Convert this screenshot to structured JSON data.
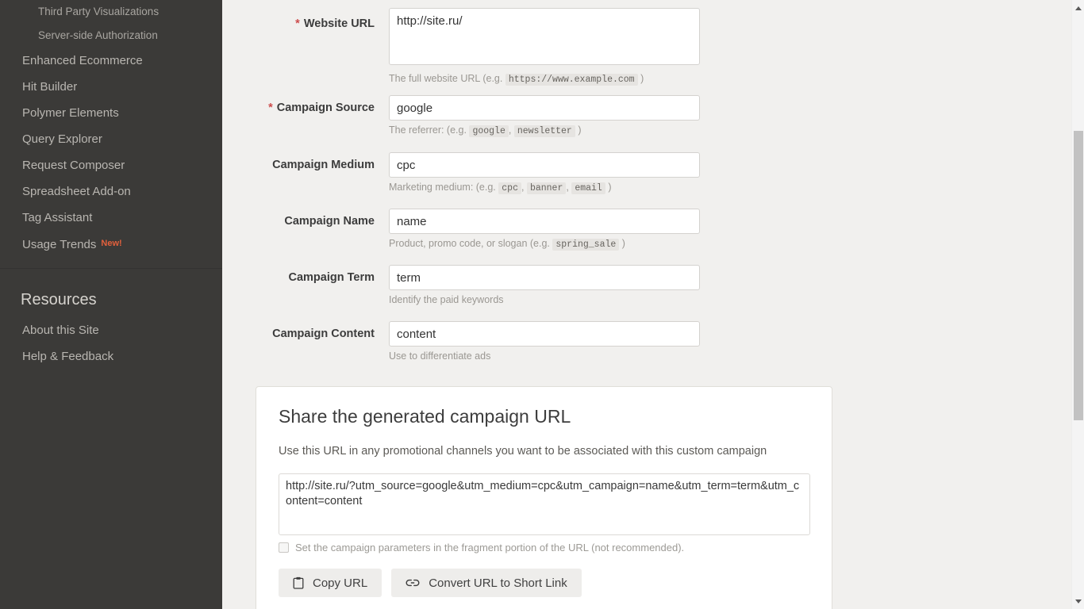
{
  "sidebar": {
    "nav_items": [
      {
        "label": "Third Party Visualizations",
        "sub": true
      },
      {
        "label": "Server-side Authorization",
        "sub": true
      },
      {
        "label": "Enhanced Ecommerce",
        "sub": false
      },
      {
        "label": "Hit Builder",
        "sub": false
      },
      {
        "label": "Polymer Elements",
        "sub": false
      },
      {
        "label": "Query Explorer",
        "sub": false
      },
      {
        "label": "Request Composer",
        "sub": false
      },
      {
        "label": "Spreadsheet Add-on",
        "sub": false
      },
      {
        "label": "Tag Assistant",
        "sub": false
      },
      {
        "label": "Usage Trends",
        "sub": false,
        "badge": "New!"
      }
    ],
    "resources_heading": "Resources",
    "resource_items": [
      {
        "label": "About this Site"
      },
      {
        "label": "Help & Feedback"
      }
    ],
    "badge_color": "#e2603c"
  },
  "form": {
    "fields": [
      {
        "label": "Website URL",
        "required": true,
        "value": "http://site.ru/",
        "hint_prefix": "The full website URL (e.g.",
        "hint_codes": [
          "https://www.example.com"
        ],
        "hint_suffix": ")"
      },
      {
        "label": "Campaign Source",
        "required": true,
        "value": "google",
        "hint_prefix": "The referrer: (e.g.",
        "hint_codes": [
          "google",
          "newsletter"
        ],
        "hint_suffix": ")"
      },
      {
        "label": "Campaign Medium",
        "required": false,
        "value": "cpc",
        "hint_prefix": "Marketing medium: (e.g.",
        "hint_codes": [
          "cpc",
          "banner",
          "email"
        ],
        "hint_suffix": ")"
      },
      {
        "label": "Campaign Name",
        "required": false,
        "value": "name",
        "hint_prefix": "Product, promo code, or slogan (e.g.",
        "hint_codes": [
          "spring_sale"
        ],
        "hint_suffix": ")"
      },
      {
        "label": "Campaign Term",
        "required": false,
        "value": "term",
        "hint_prefix": "Identify the paid keywords",
        "hint_codes": [],
        "hint_suffix": ""
      },
      {
        "label": "Campaign Content",
        "required": false,
        "value": "content",
        "hint_prefix": "Use to differentiate ads",
        "hint_codes": [],
        "hint_suffix": ""
      }
    ],
    "required_marker": "*"
  },
  "share_card": {
    "title": "Share the generated campaign URL",
    "subtitle": "Use this URL in any promotional channels you want to be associated with this custom campaign",
    "generated_url": "http://site.ru/?utm_source=google&utm_medium=cpc&utm_campaign=name&utm_term=term&utm_content=content",
    "fragment_checkbox_label": "Set the campaign parameters in the fragment portion of the URL (not recommended).",
    "fragment_checkbox_checked": false,
    "copy_button": "Copy URL",
    "shorten_button": "Convert URL to Short Link"
  }
}
